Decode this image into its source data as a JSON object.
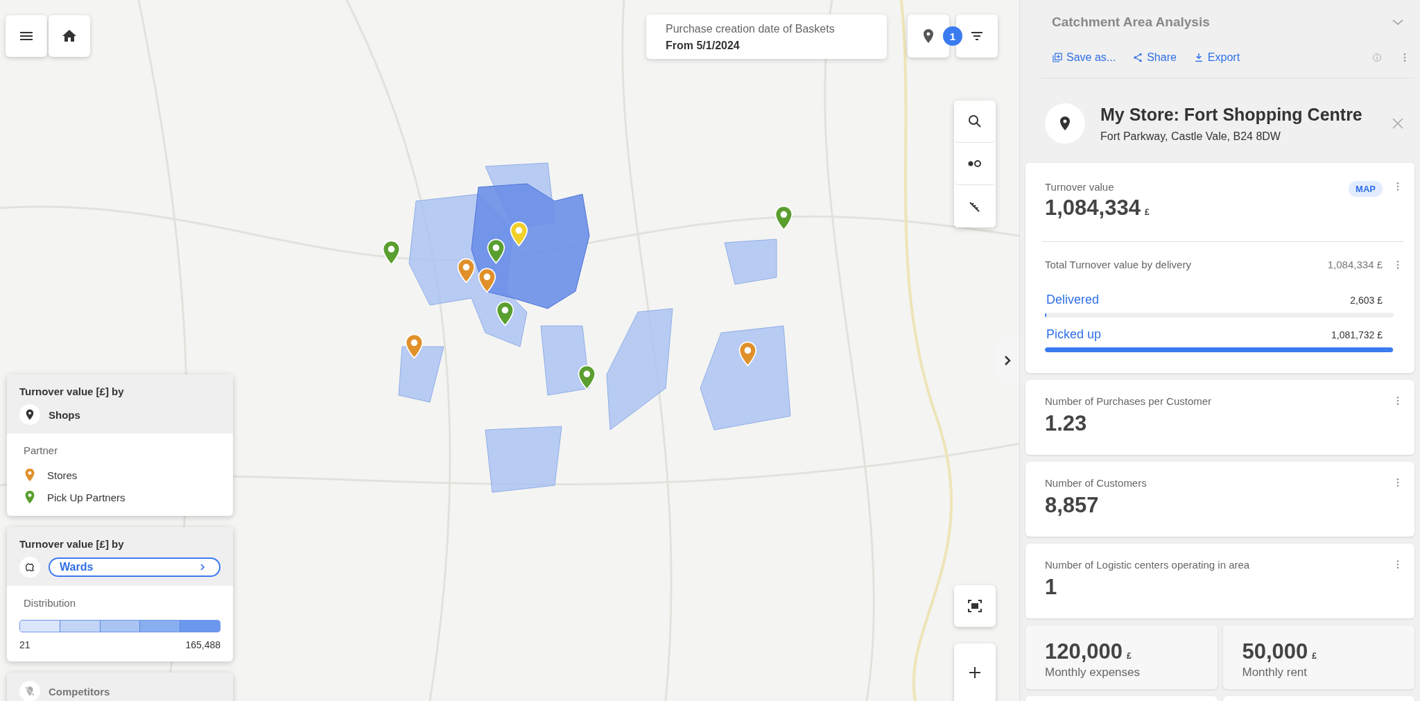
{
  "date_filter": {
    "label": "Purchase creation date of Baskets",
    "value": "From 5/1/2024"
  },
  "filter_badge": "1",
  "legend_panels": [
    {
      "kind": "layer",
      "title": "Turnover value [£] by",
      "layer": "Shops",
      "section": "Partner",
      "items": [
        {
          "label": "Stores",
          "color": "#e0902a"
        },
        {
          "label": "Pick Up Partners",
          "color": "#5a9e2f"
        }
      ]
    },
    {
      "kind": "distribution",
      "title": "Turnover value [£] by",
      "layer": "Wards",
      "section": "Distribution",
      "min": "21",
      "max": "165,488"
    },
    {
      "kind": "collapsed",
      "layer": "Competitors"
    }
  ],
  "panel": {
    "title": "Catchment Area Analysis",
    "actions": [
      {
        "kind": "save",
        "label": "Save as..."
      },
      {
        "kind": "share",
        "label": "Share"
      },
      {
        "kind": "export",
        "label": "Export"
      }
    ],
    "store": {
      "name": "My Store: Fort Shopping Centre",
      "address": "Fort Parkway, Castle Vale, B24 8DW"
    },
    "cards": [
      {
        "kind": "main",
        "label": "Turnover value",
        "badge": "MAP",
        "value": "1,084,334",
        "unit": "£",
        "breakdown_label": "Total Turnover value by delivery",
        "breakdown_value": "1,084,334 £",
        "rows": [
          {
            "label": "Delivered",
            "value": "2,603 £",
            "level": 0.0024
          },
          {
            "label": "Picked up",
            "value": "1,081,732 £",
            "level": 0.9976
          }
        ]
      },
      {
        "kind": "metric",
        "label": "Number of Purchases per Customer",
        "value": "1.23"
      },
      {
        "kind": "metric",
        "label": "Number of Customers",
        "value": "8,857"
      },
      {
        "kind": "metric",
        "label": "Number of Logistic centers operating in area",
        "value": "1"
      },
      {
        "kind": "small",
        "value": "120,000",
        "unit": "£",
        "label": "Monthly expenses"
      },
      {
        "kind": "small",
        "value": "50,000",
        "unit": "£",
        "label": "Monthly rent"
      }
    ]
  }
}
